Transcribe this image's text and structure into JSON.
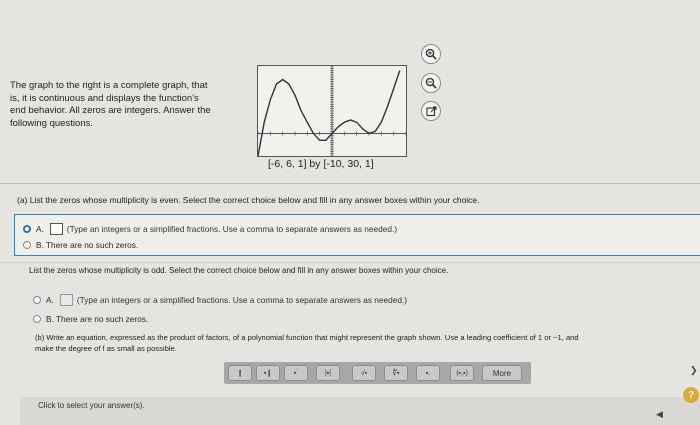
{
  "prompt": {
    "lines": [
      "The graph to the right is a complete graph, that",
      "is, it is continuous and displays the function's",
      "end behavior. All zeros are integers. Answer the",
      "following questions."
    ]
  },
  "graph": {
    "caption": "[-6, 6, 1] by [-10, 30, 1]",
    "curve": {
      "x_range": [
        -6,
        6
      ],
      "y_range": [
        -10,
        30
      ],
      "points": [
        [
          -6,
          -10
        ],
        [
          -5.5,
          5
        ],
        [
          -5,
          15
        ],
        [
          -4.5,
          22
        ],
        [
          -4,
          24
        ],
        [
          -3.5,
          22
        ],
        [
          -3,
          17
        ],
        [
          -2.5,
          10
        ],
        [
          -2,
          5
        ],
        [
          -1.5,
          0
        ],
        [
          -1,
          -3
        ],
        [
          -0.5,
          -3
        ],
        [
          0,
          0
        ],
        [
          0.5,
          3
        ],
        [
          1,
          5
        ],
        [
          1.5,
          6
        ],
        [
          2,
          5
        ],
        [
          2.5,
          2
        ],
        [
          3,
          0
        ],
        [
          3.5,
          1
        ],
        [
          4,
          5
        ],
        [
          4.5,
          12
        ],
        [
          5,
          20
        ],
        [
          5.5,
          28
        ]
      ]
    }
  },
  "tools": {
    "icons": [
      "zoom-in-icon",
      "zoom-out-icon",
      "external-link-icon"
    ]
  },
  "part_a": {
    "heading": "(a) List the zeros whose multiplicity is even. Select the correct choice below and fill in any answer boxes within your choice.",
    "option_a_letter": "A.",
    "option_a_hint": "(Type an integers or a simplified fractions. Use a comma to separate answers as needed.)",
    "option_b": "B. There are no such zeros."
  },
  "odd": {
    "heading": "List the zeros whose multiplicity is odd. Select the correct choice below and fill in any answer boxes within your choice.",
    "option_a_letter": "A.",
    "option_a_hint": "(Type an integers or a simplified fractions. Use a comma to separate answers as needed.)",
    "option_b": "B. There are no such zeros."
  },
  "part_b": {
    "line1": "(b) Write an equation, expressed as the product of factors, of a polynomial function that might represent the graph shown. Use a leading coefficient of 1 or −1, and",
    "line2": "make the degree of f as small as possible."
  },
  "toolbar": {
    "buttons": [
      "❙",
      "▪❙",
      "▪˙",
      "|▪|",
      "√▪",
      "∜▪",
      "▪.",
      "(▪,▪)"
    ],
    "more_label": "More"
  },
  "status": {
    "text": "Click to select your answer(s).",
    "help_label": "?"
  }
}
